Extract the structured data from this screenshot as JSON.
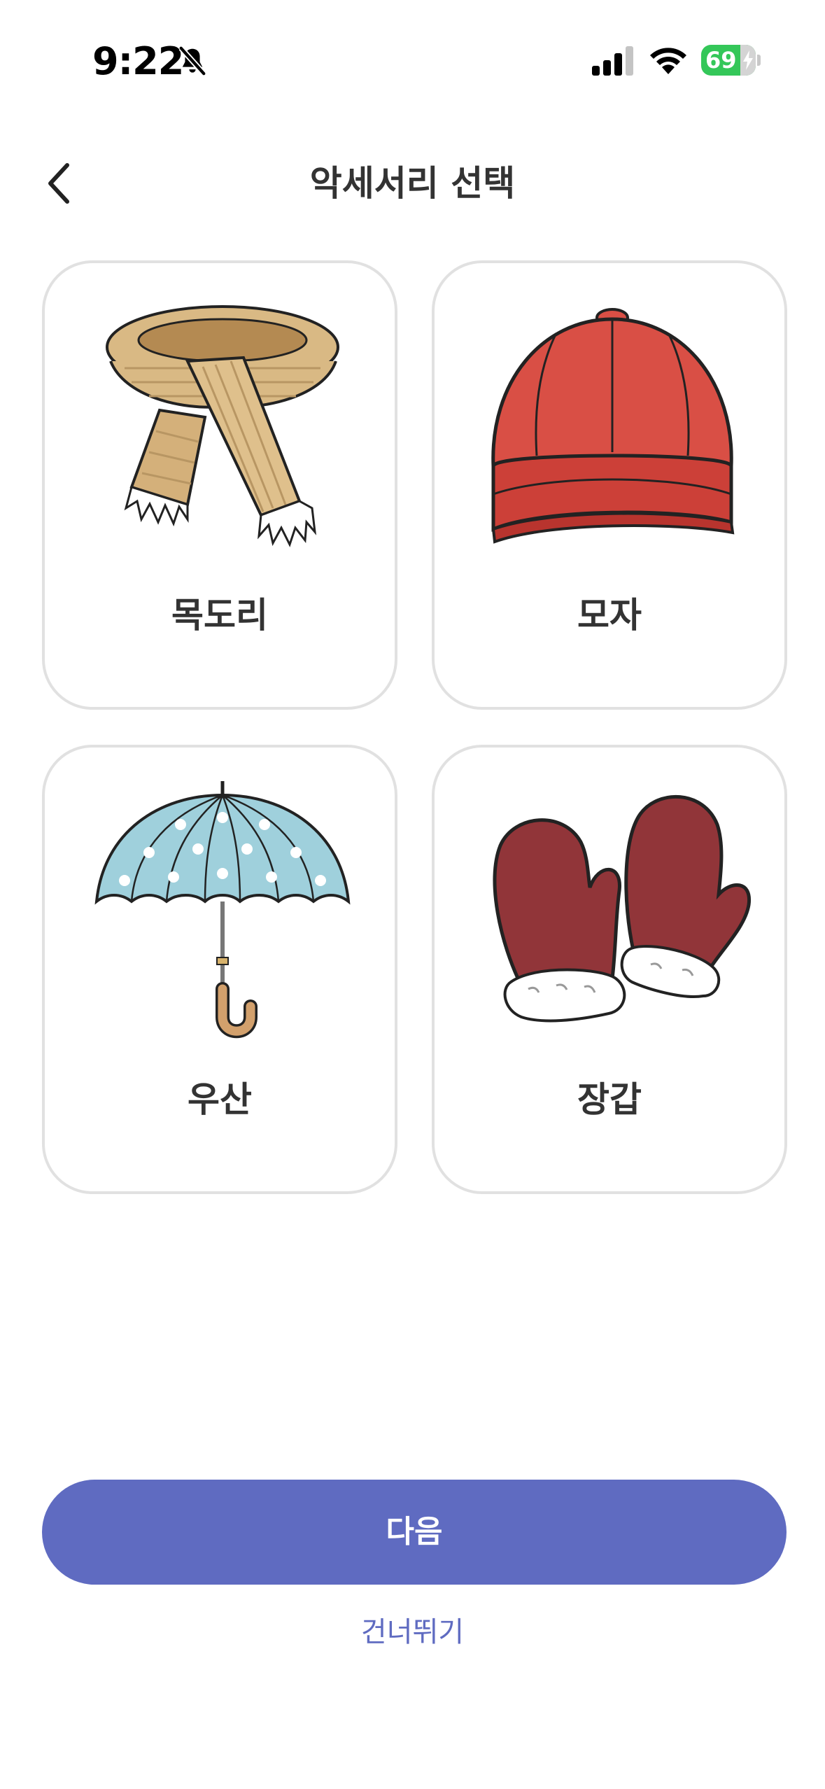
{
  "status_bar": {
    "time": "9:22",
    "battery_percent": "69",
    "silent_mode_icon": "bell-slash-icon",
    "signal_icon": "cellular-signal-icon",
    "wifi_icon": "wifi-icon",
    "battery_color": "#34c759"
  },
  "header": {
    "title": "악세서리 선택",
    "back_icon": "chevron-left-icon"
  },
  "accessories": [
    {
      "label": "목도리",
      "icon": "scarf-icon"
    },
    {
      "label": "모자",
      "icon": "cap-icon"
    },
    {
      "label": "우산",
      "icon": "umbrella-icon"
    },
    {
      "label": "장갑",
      "icon": "mittens-icon"
    }
  ],
  "actions": {
    "next_label": "다음",
    "skip_label": "건너뛰기"
  },
  "colors": {
    "primary": "#5f6bc1",
    "card_border": "#e1e1e1",
    "text": "#333333"
  }
}
